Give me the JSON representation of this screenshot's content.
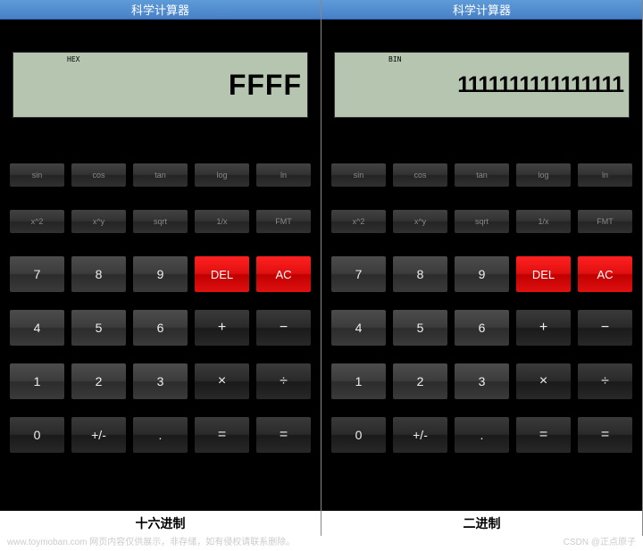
{
  "left": {
    "title": "科学计算器",
    "mode": "HEX",
    "value": "FFFF",
    "footer": "十六进制"
  },
  "right": {
    "title": "科学计算器",
    "mode": "BIN",
    "value": "1111111111111111",
    "footer": "二进制"
  },
  "fn_row1": {
    "sin": "sin",
    "cos": "cos",
    "tan": "tan",
    "log": "log",
    "ln": "ln"
  },
  "fn_row2": {
    "x2": "x^2",
    "xy": "x^y",
    "sqrt": "sqrt",
    "inv": "1/x",
    "fmt": "FMT"
  },
  "num": {
    "7": "7",
    "8": "8",
    "9": "9",
    "del": "DEL",
    "ac": "AC",
    "4": "4",
    "5": "5",
    "6": "6",
    "plus": "+",
    "minus": "−",
    "1": "1",
    "2": "2",
    "3": "3",
    "mul": "×",
    "div": "÷",
    "0": "0",
    "pm": "+/-",
    "dot": ".",
    "eq1": "=",
    "eq2": "="
  },
  "watermark_left": "www.toymoban.com 网页内容仅供展示，非存储，如有侵权请联系删除。",
  "watermark_right": "CSDN @正点原子"
}
